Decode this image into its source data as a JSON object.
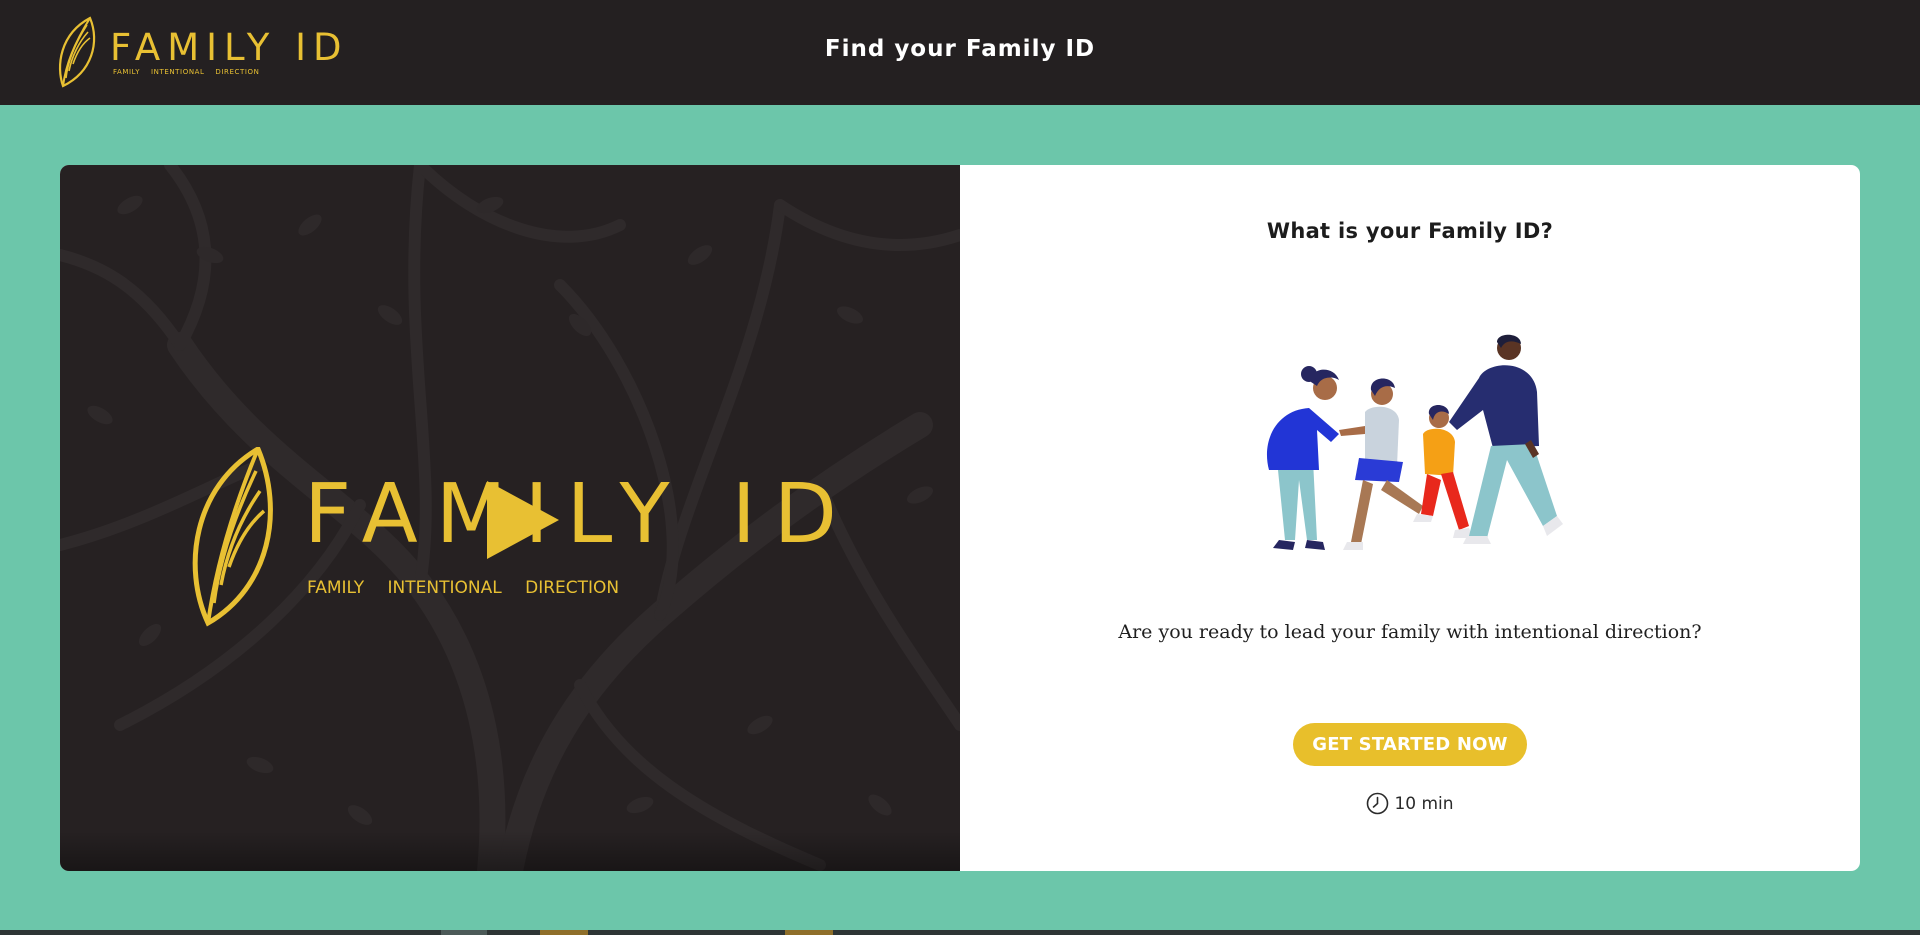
{
  "header": {
    "logo": {
      "wordmark": "FAMILY ID",
      "tagline": "FAMILY INTENTIONAL DIRECTION"
    },
    "title": "Find your Family ID"
  },
  "video": {
    "poster_wordmark": "FAMILY ID",
    "poster_tagline": "FAMILY INTENTIONAL DIRECTION"
  },
  "info": {
    "title": "What is your Family ID?",
    "text": "Are you ready to lead your family with intentional direction?",
    "cta_label": "GET STARTED NOW",
    "duration": "10 min"
  },
  "colors": {
    "brand_gold": "#e8c033",
    "header_bg": "#242021",
    "page_bg": "#6cc6aa",
    "card_bg": "#ffffff"
  }
}
